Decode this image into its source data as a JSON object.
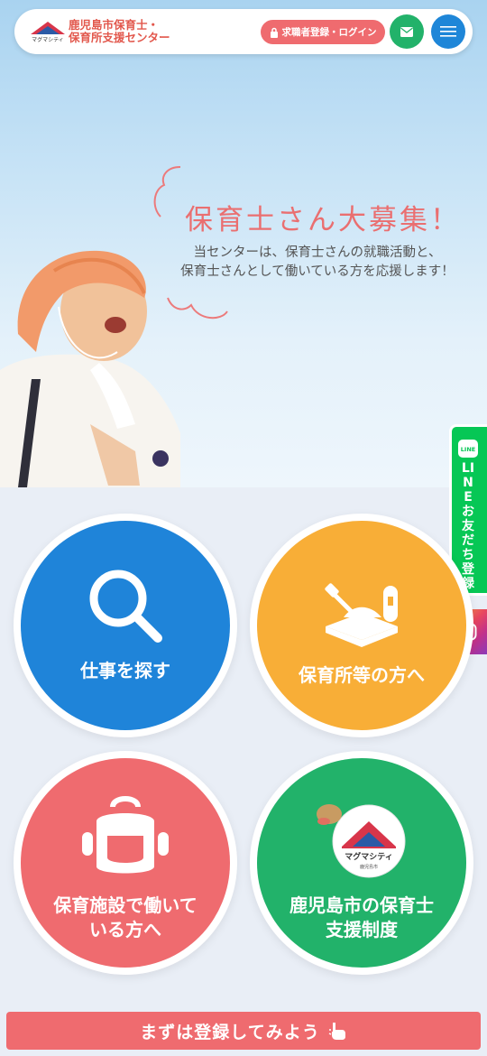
{
  "header": {
    "logo_line1": "鹿児島市保育士・",
    "logo_line2": "保育所支援センター",
    "logo_badge_name": "マグマシティ",
    "logo_badge_sub": "鹿児島市",
    "login_label": "求職者登録・ログイン",
    "mail_icon": "envelope-icon",
    "menu_icon": "hamburger-icon"
  },
  "hero": {
    "title": "保育士さん大募集！",
    "text_line1": "当センターは、保育士さんの就職活動と、",
    "text_line2": "保育士さんとして働いている方を応援します！"
  },
  "side": {
    "line_label": "LINEお友だち登録",
    "line_icon": "line-icon",
    "instagram_icon": "instagram-icon"
  },
  "menu": {
    "items": [
      {
        "label": "仕事を探す",
        "icon": "search-icon",
        "color": "#1f84d9"
      },
      {
        "label": "保育所等の方へ",
        "icon": "sandbox-icon",
        "color": "#f8ae37"
      },
      {
        "label": "保育施設で働いている方へ",
        "line1": "保育施設で働いて",
        "line2": "いる方へ",
        "icon": "backpack-icon",
        "color": "#ef6b6f"
      },
      {
        "label": "鹿児島市の保育士支援制度",
        "line1": "鹿児島市の保育士",
        "line2": "支援制度",
        "icon": "magma-city-logo-icon",
        "badge_name": "マグマシティ",
        "badge_sub": "鹿児島市",
        "color": "#22b26a"
      }
    ]
  },
  "cta": {
    "label": "まずは登録してみよう",
    "icon": "pointing-hand-icon"
  },
  "colors": {
    "brand_red": "#e2574c",
    "pink": "#ef6b6f",
    "blue": "#1f84d9",
    "orange": "#f8ae37",
    "green": "#22b26a",
    "line_green": "#06c755"
  }
}
